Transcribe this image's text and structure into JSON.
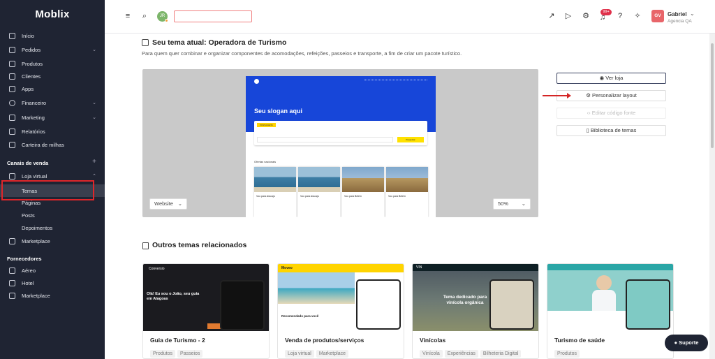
{
  "sidebar": {
    "logo": "Moblix",
    "items": [
      {
        "label": "Início",
        "icon": "home-icon"
      },
      {
        "label": "Pedidos",
        "icon": "document-icon"
      },
      {
        "label": "Produtos",
        "icon": "box-icon"
      },
      {
        "label": "Clientes",
        "icon": "users-icon"
      },
      {
        "label": "Apps",
        "icon": "grid-icon"
      },
      {
        "label": "Financeiro",
        "icon": "dollar-icon"
      },
      {
        "label": "Marketing",
        "icon": "megaphone-icon"
      },
      {
        "label": "Relatórios",
        "icon": "chart-icon"
      },
      {
        "label": "Carteira de milhas",
        "icon": "wallet-icon"
      }
    ],
    "section_channels": "Canais de venda",
    "loja_virtual": "Loja virtual",
    "loja_sub": [
      "Temas",
      "Páginas",
      "Posts",
      "Depoimentos"
    ],
    "marketplace": "Marketplace",
    "section_suppliers": "Fornecedores",
    "suppliers": [
      "Aéreo",
      "Hotel",
      "Marketplace"
    ]
  },
  "topbar": {
    "avatar_initials": "JR",
    "notification_count": "99+",
    "user_initials": "GV",
    "user_name": "Gabriel",
    "user_agency": "Agencia QA"
  },
  "main": {
    "current_theme_title": "Seu tema atual: Operadora de Turismo",
    "current_theme_desc": "Para quem quer combinar e organizar componentes de acomodações, refeições, passeios e transporte, a fim de criar um pacote turístico.",
    "preview": {
      "slogan": "Seu slogan aqui",
      "offers_label": "Ofertas nacionais",
      "passagens": "PASSAGENS",
      "search_btn": "Pesquisar",
      "cards": [
        "Voo para Aracaju",
        "Voo para Aracaju",
        "Voo para Belém",
        "Voo para Belém"
      ],
      "device_select": "Website",
      "zoom_select": "50%"
    },
    "buttons": {
      "ver_loja": "Ver loja",
      "personalizar": "Personalizar layout",
      "editar": "Editar código fonte",
      "biblioteca": "Biblioteca de temas"
    },
    "others_title": "Outros temas relacionados",
    "themes": [
      {
        "name": "Guia de Turismo - 2",
        "tags": [
          "Produtos",
          "Passeios"
        ],
        "brand": "Conversio",
        "headline": "Olá! Eu sou o João, seu guia em Alagoas"
      },
      {
        "name": "Venda de produtos/serviços",
        "tags": [
          "Loja virtual",
          "Marketplace"
        ],
        "brand": "Moveo",
        "headline": "Recomendado para você"
      },
      {
        "name": "Vinícolas",
        "tags": [
          "Vinícola",
          "Experiências",
          "Bilheteria Digital"
        ],
        "brand": "VIN",
        "headline": "Tema dedicado para vinícola orgânica"
      },
      {
        "name": "Turismo de saúde",
        "tags": [
          "Produtos"
        ],
        "brand": "",
        "headline": ""
      }
    ],
    "support_label": "Suporte"
  }
}
